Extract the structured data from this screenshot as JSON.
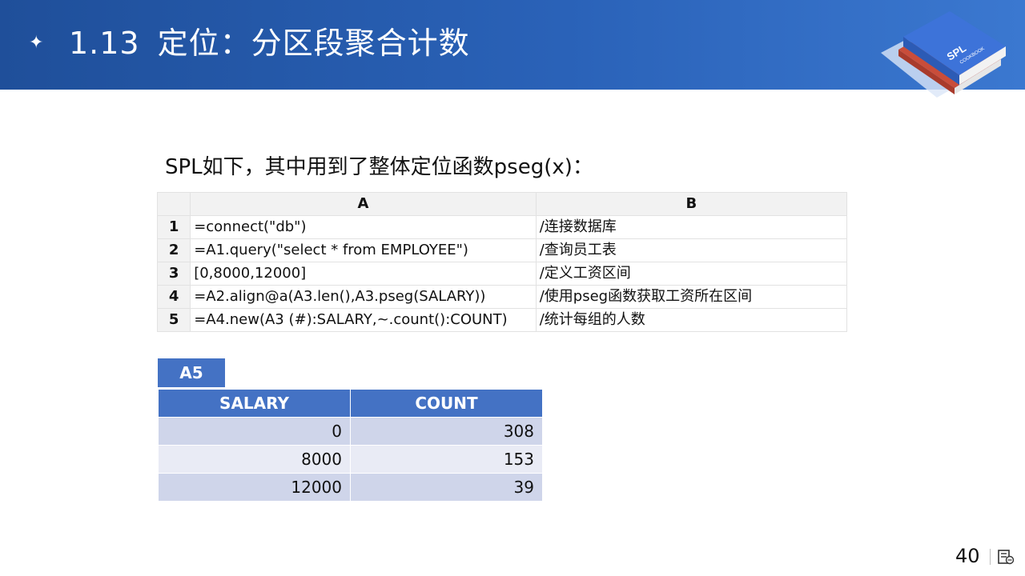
{
  "header": {
    "bullet_icon": "sparkle-icon",
    "section_number": "1.13",
    "title": "定位：分区段聚合计数"
  },
  "logo": {
    "icon": "spl-cookbook-book-logo",
    "text": "SPL",
    "subtext": "COOKBOOK"
  },
  "intro": "SPL如下，其中用到了整体定位函数pseg(x)：",
  "code": {
    "columns": [
      "A",
      "B"
    ],
    "rows": [
      {
        "num": "1",
        "a": "=connect(\"db\")",
        "b": "/连接数据库"
      },
      {
        "num": "2",
        "a": "=A1.query(\"select * from EMPLOYEE\")",
        "b": "/查询员工表"
      },
      {
        "num": "3",
        "a": "[0,8000,12000]",
        "b": "/定义工资区间"
      },
      {
        "num": "4",
        "a": "=A2.align@a(A3.len(),A3.pseg(SALARY))",
        "b": "/使用pseg函数获取工资所在区间"
      },
      {
        "num": "5",
        "a": "=A4.new(A3 (#):SALARY,~.count():COUNT)",
        "b": "/统计每组的人数"
      }
    ]
  },
  "result": {
    "label": "A5",
    "columns": [
      "SALARY",
      "COUNT"
    ],
    "rows": [
      {
        "salary": "0",
        "count": "308"
      },
      {
        "salary": "8000",
        "count": "153"
      },
      {
        "salary": "12000",
        "count": "39"
      }
    ]
  },
  "footer": {
    "page_number": "40",
    "icon": "slide-note-icon"
  },
  "colors": {
    "header_start": "#1f4f9a",
    "header_end": "#3b78d0",
    "table_accent": "#4472c4",
    "row_odd": "#cfd5ea",
    "row_even": "#e9ebf5"
  }
}
